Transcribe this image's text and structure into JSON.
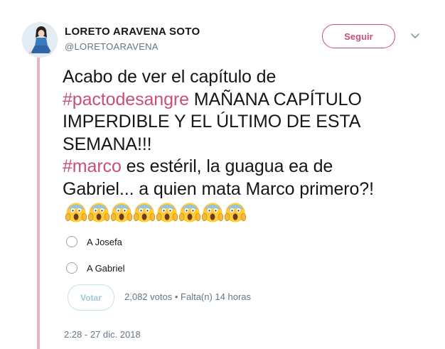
{
  "author": {
    "name": "LORETO ARAVENA SOTO",
    "handle": "@LORETOARAVENA"
  },
  "follow_label": "Seguir",
  "tweet": {
    "lines": [
      [
        {
          "text": "Acabo de ver el capítulo de",
          "hashtag": false
        }
      ],
      [
        {
          "text": "#pactodesangre",
          "hashtag": true
        },
        {
          "text": " MAÑANA CAPÍTULO",
          "hashtag": false
        }
      ],
      [
        {
          "text": "IMPERDIBLE Y EL ÚLTIMO DE ESTA",
          "hashtag": false
        }
      ],
      [
        {
          "text": "SEMANA!!!",
          "hashtag": false
        }
      ],
      [
        {
          "text": "#marco",
          "hashtag": true
        },
        {
          "text": " es estéril, la guagua ea de",
          "hashtag": false
        }
      ],
      [
        {
          "text": "Gabriel... a quien mata Marco primero?!",
          "hashtag": false
        }
      ]
    ],
    "emoji": "face-screaming-in-fear",
    "emoji_count": 8
  },
  "poll": {
    "options": [
      "A Josefa",
      "A Gabriel"
    ],
    "vote_label": "Votar",
    "votes": "2,082 votos",
    "separator": "•",
    "time_left": "Falta(n) 14 horas"
  },
  "timestamp": "2:28 - 27 dic. 2018",
  "colors": {
    "accent": "#c85072",
    "thread_line": "#e3b7c0",
    "muted_text": "#657786",
    "vote_border": "#bfe3ee"
  }
}
